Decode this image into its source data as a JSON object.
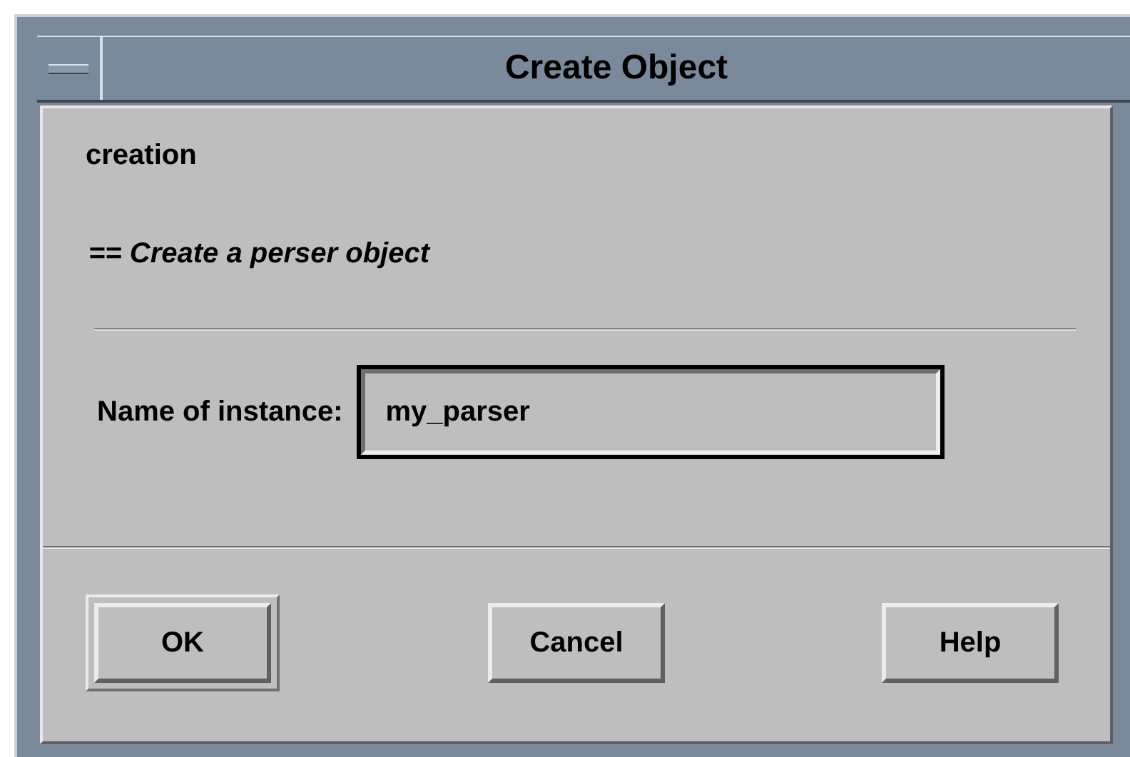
{
  "window": {
    "title": "Create Object"
  },
  "heading": "creation",
  "description": "== Create a perser object",
  "field": {
    "label": "Name of instance:",
    "value": "my_parser",
    "focused": true
  },
  "buttons": [
    {
      "label": "OK",
      "default": true
    },
    {
      "label": "Cancel",
      "default": false
    },
    {
      "label": "Help",
      "default": false
    }
  ]
}
